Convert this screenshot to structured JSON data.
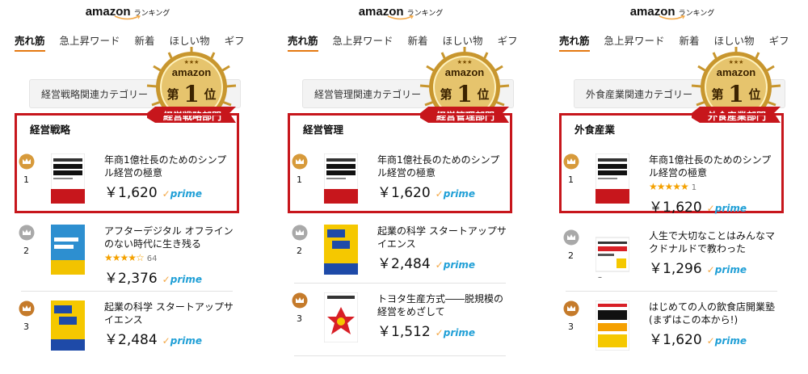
{
  "logo": {
    "word": "amazon",
    "ranking": "ランキング"
  },
  "medal": {
    "top": "amazon",
    "first": "第",
    "one": "1",
    "place": "位"
  },
  "tabs": [
    "売れ筋",
    "急上昇ワード",
    "新着",
    "ほしい物",
    "ギフ"
  ],
  "prime_label": "prime",
  "panels": [
    {
      "category_bar": "経営戦略関連カテゴリー",
      "ribbon": "経営戦略部門",
      "category_title": "経営戦略",
      "items": [
        {
          "rank": "1",
          "title": "年商1億社長のためのシンプル経営の極意",
          "price": "￥1,620",
          "reviews": ""
        },
        {
          "rank": "2",
          "title": "アフターデジタル オフラインのない時代に生き残る",
          "price": "￥2,376",
          "reviews": "64"
        },
        {
          "rank": "3",
          "title": "起業の科学 スタートアップサイエンス",
          "price": "￥2,484",
          "reviews": ""
        }
      ]
    },
    {
      "category_bar": "経営管理関連カテゴリー",
      "ribbon": "経営管理部門",
      "category_title": "経営管理",
      "items": [
        {
          "rank": "1",
          "title": "年商1億社長のためのシンプル経営の極意",
          "price": "￥1,620",
          "reviews": ""
        },
        {
          "rank": "2",
          "title": "起業の科学 スタートアップサイエンス",
          "price": "￥2,484",
          "reviews": ""
        },
        {
          "rank": "3",
          "title": "トヨタ生産方式――脱規模の経営をめざして",
          "price": "￥1,512",
          "reviews": ""
        }
      ]
    },
    {
      "category_bar": "外食産業関連カテゴリー",
      "ribbon": "外食産業部門",
      "category_title": "外食産業",
      "items": [
        {
          "rank": "1",
          "title": "年商1億社長のためのシンプル経営の極意",
          "price": "￥1,620",
          "reviews": "1"
        },
        {
          "rank": "2",
          "title": "人生で大切なことはみんなマクドナルドで教わった",
          "price": "￥1,296",
          "reviews": "",
          "extra": "–"
        },
        {
          "rank": "3",
          "title": "はじめての人の飲食店開業塾 (まずはこの本から!)",
          "price": "￥1,620",
          "reviews": ""
        }
      ]
    }
  ],
  "colors": {
    "highlight": "#c7161c",
    "tab_underline": "#e47911",
    "prime": "#1f9fd6",
    "star": "#f4a100",
    "gold": "#c8962e"
  }
}
